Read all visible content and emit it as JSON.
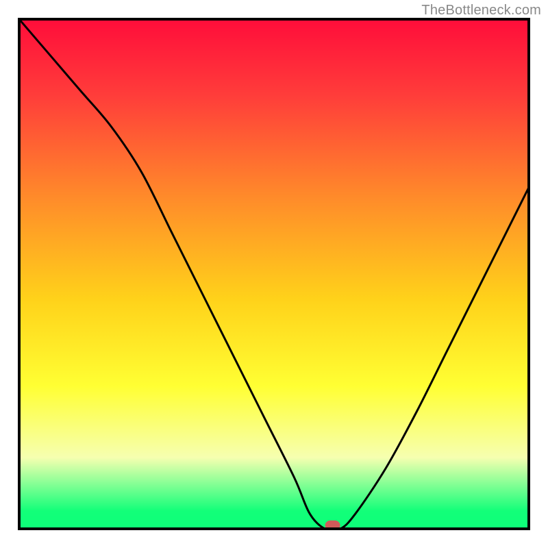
{
  "watermark": "TheBottleneck.com",
  "chart_data": {
    "type": "line",
    "title": "",
    "xlabel": "",
    "ylabel": "",
    "xlim": [
      0,
      100
    ],
    "ylim": [
      0,
      100
    ],
    "grid": false,
    "series": [
      {
        "name": "bottleneck-curve",
        "x": [
          0,
          6,
          12,
          18,
          24,
          30,
          36,
          42,
          48,
          54,
          57,
          60,
          63,
          66,
          72,
          78,
          84,
          90,
          96,
          100
        ],
        "y": [
          100,
          93,
          86,
          79,
          70,
          58,
          46,
          34,
          22,
          10,
          3,
          0,
          0,
          3,
          12,
          23,
          35,
          47,
          59,
          67
        ]
      }
    ],
    "marker": {
      "x": 61.5,
      "y": 0.7
    },
    "gradient_bands": [
      {
        "stop": 0.0,
        "color": "#ff0d3a"
      },
      {
        "stop": 0.15,
        "color": "#ff3d3a"
      },
      {
        "stop": 0.35,
        "color": "#ff8b2a"
      },
      {
        "stop": 0.55,
        "color": "#ffd21a"
      },
      {
        "stop": 0.72,
        "color": "#ffff33"
      },
      {
        "stop": 0.86,
        "color": "#f6ffb0"
      },
      {
        "stop": 0.965,
        "color": "#12ff79"
      },
      {
        "stop": 1.0,
        "color": "#0dff79"
      }
    ],
    "frame": {
      "stroke": "#000000",
      "width": 4
    },
    "marker_style": {
      "fill": "#d05a5a",
      "rx": 8,
      "w": 22,
      "h": 14
    }
  }
}
